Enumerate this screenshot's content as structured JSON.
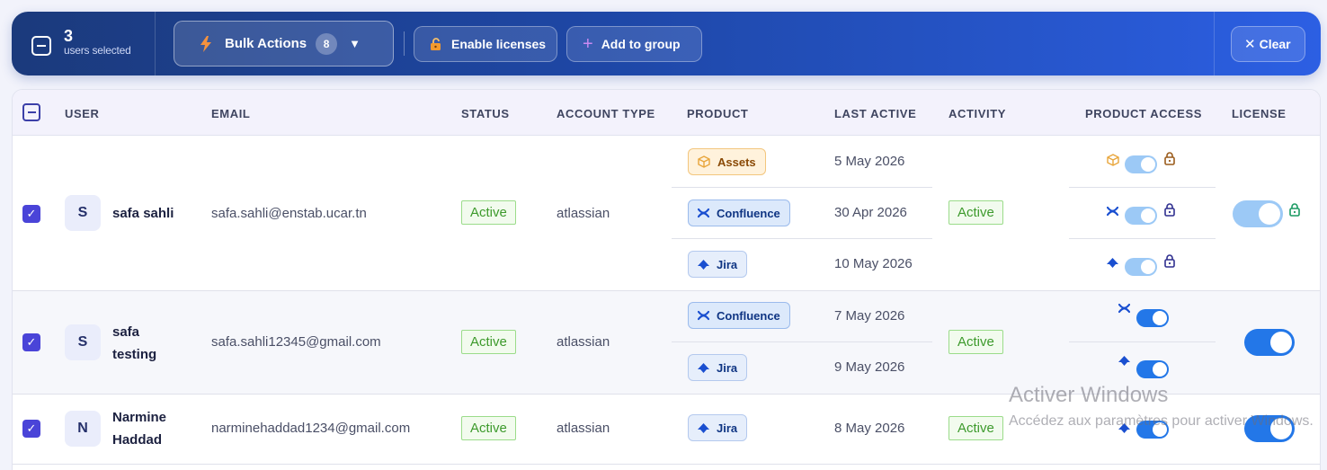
{
  "bulkbar": {
    "count": "3",
    "count_label": "users selected",
    "bulk_actions_label": "Bulk Actions",
    "bulk_actions_badge": "8",
    "enable_licenses_label": "Enable licenses",
    "add_to_group_label": "Add to group",
    "clear_label": "Clear"
  },
  "table": {
    "headers": [
      "USER",
      "EMAIL",
      "STATUS",
      "ACCOUNT TYPE",
      "PRODUCT",
      "LAST ACTIVE",
      "ACTIVITY",
      "PRODUCT ACCESS",
      "LICENSE"
    ],
    "rows": [
      {
        "initial": "S",
        "name": "safa sahli",
        "email": "safa.sahli@enstab.ucar.tn",
        "status": "Active",
        "account_type": "atlassian",
        "activity": "Active",
        "products": [
          {
            "name": "Assets",
            "last_active": "5 May 2026",
            "access_on": false
          },
          {
            "name": "Confluence",
            "last_active": "30 Apr 2026",
            "access_on": false
          },
          {
            "name": "Jira",
            "last_active": "10 May 2026",
            "access_on": false
          }
        ],
        "license_on": false
      },
      {
        "initial": "S",
        "name": "safa testing",
        "email": "safa.sahli12345@gmail.com",
        "status": "Active",
        "account_type": "atlassian",
        "activity": "Active",
        "products": [
          {
            "name": "Confluence",
            "last_active": "7 May 2026",
            "access_on": true
          },
          {
            "name": "Jira",
            "last_active": "9 May 2026",
            "access_on": true
          }
        ],
        "license_on": true
      },
      {
        "initial": "N",
        "name": "Narmine Haddad",
        "email": "narminehaddad1234@gmail.com",
        "status": "Active",
        "account_type": "atlassian",
        "activity": "Active",
        "products": [
          {
            "name": "Jira",
            "last_active": "8 May 2026",
            "access_on": true
          }
        ],
        "license_on": true
      }
    ]
  },
  "watermark": {
    "title": "Activer Windows",
    "subtitle": "Accédez aux paramètres pour activer Windows."
  },
  "colors": {
    "accent": "#2377e8",
    "checkbox": "#4a44d8",
    "status_green": "#3d9a2c"
  }
}
